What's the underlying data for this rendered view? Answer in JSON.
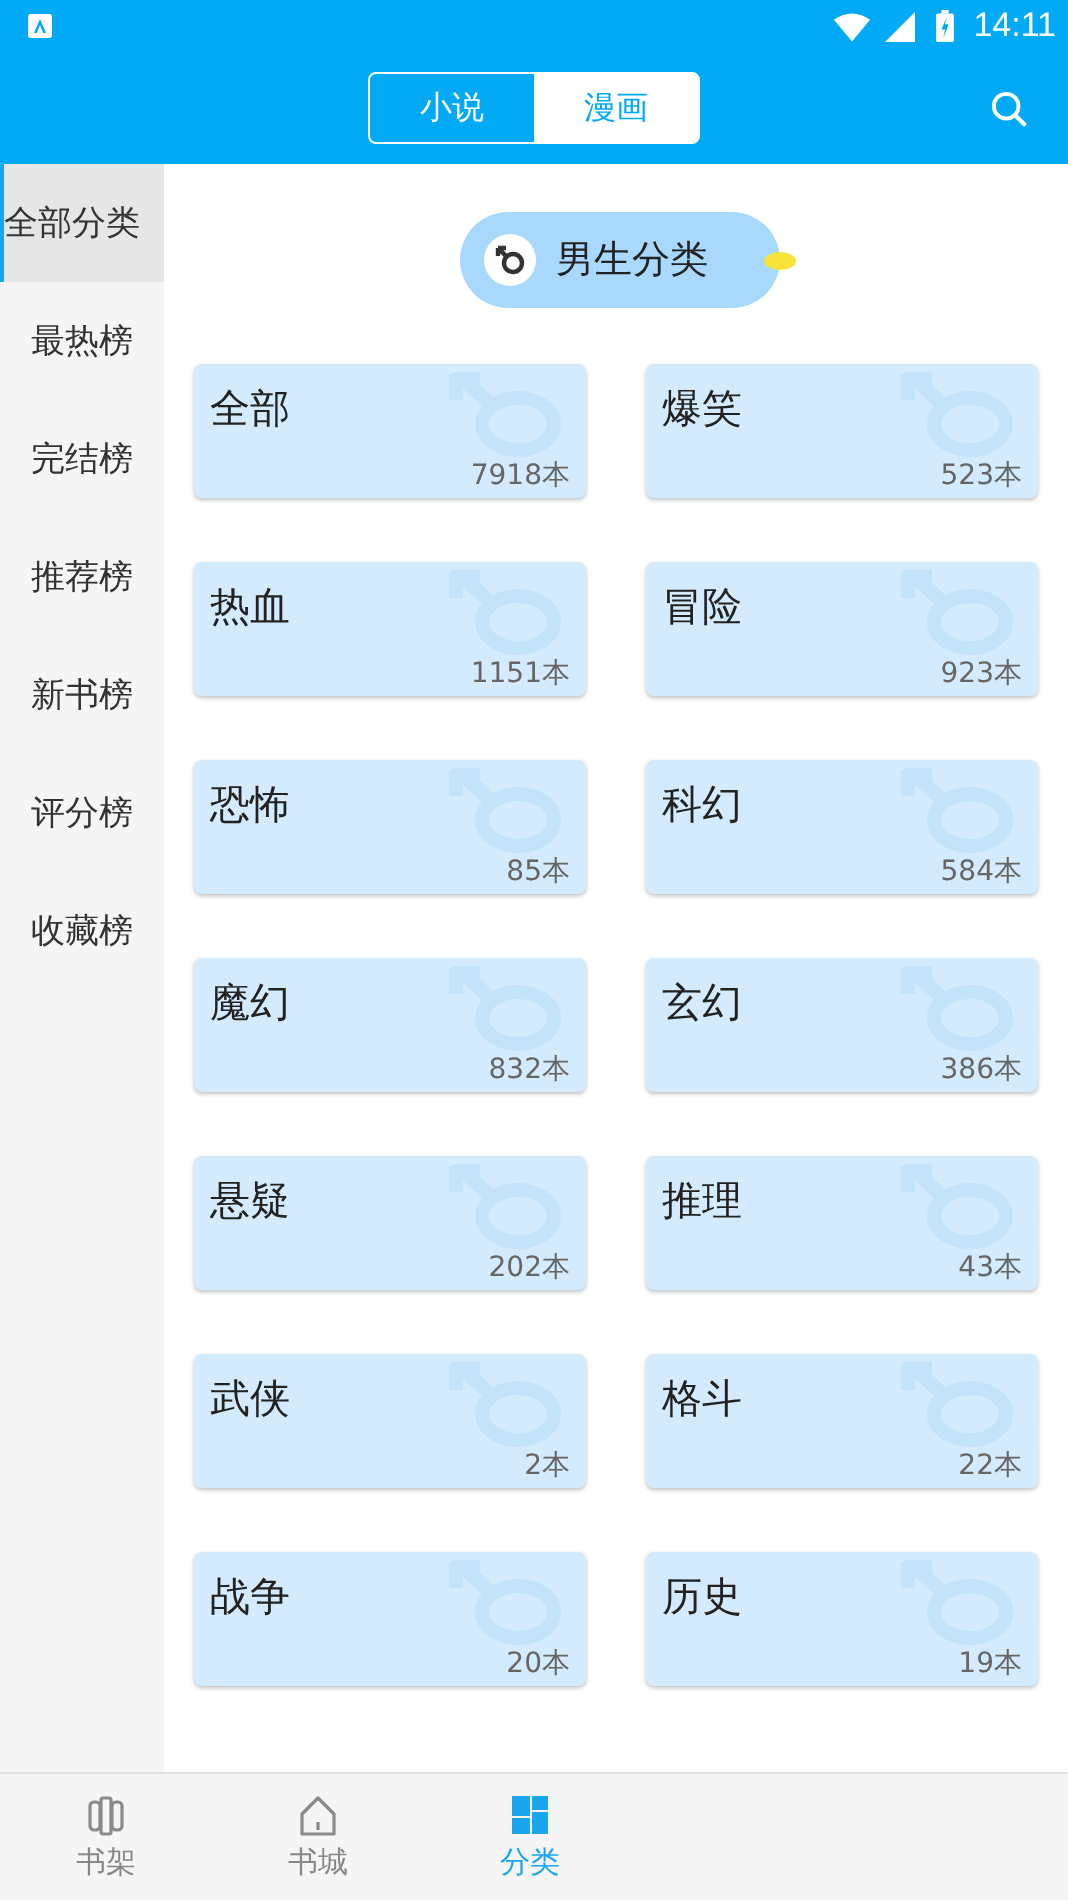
{
  "status_bar": {
    "time": "14:11"
  },
  "toolbar": {
    "tabs": [
      {
        "label": "小说",
        "selected": false
      },
      {
        "label": "漫画",
        "selected": true
      }
    ]
  },
  "sidebar": {
    "items": [
      {
        "label": "全部分类",
        "selected": true
      },
      {
        "label": "最热榜",
        "selected": false
      },
      {
        "label": "完结榜",
        "selected": false
      },
      {
        "label": "推荐榜",
        "selected": false
      },
      {
        "label": "新书榜",
        "selected": false
      },
      {
        "label": "评分榜",
        "selected": false
      },
      {
        "label": "收藏榜",
        "selected": false
      }
    ]
  },
  "section": {
    "title": "男生分类"
  },
  "categories": [
    {
      "name": "全部",
      "count": "7918本"
    },
    {
      "name": "爆笑",
      "count": "523本"
    },
    {
      "name": "热血",
      "count": "1151本"
    },
    {
      "name": "冒险",
      "count": "923本"
    },
    {
      "name": "恐怖",
      "count": "85本"
    },
    {
      "name": "科幻",
      "count": "584本"
    },
    {
      "name": "魔幻",
      "count": "832本"
    },
    {
      "name": "玄幻",
      "count": "386本"
    },
    {
      "name": "悬疑",
      "count": "202本"
    },
    {
      "name": "推理",
      "count": "43本"
    },
    {
      "name": "武侠",
      "count": "2本"
    },
    {
      "name": "格斗",
      "count": "22本"
    },
    {
      "name": "战争",
      "count": "20本"
    },
    {
      "name": "历史",
      "count": "19本"
    }
  ],
  "bottom_nav": [
    {
      "label": "书架",
      "kind": "shelf",
      "selected": false
    },
    {
      "label": "书城",
      "kind": "home",
      "selected": false
    },
    {
      "label": "分类",
      "kind": "grid",
      "selected": true
    }
  ]
}
